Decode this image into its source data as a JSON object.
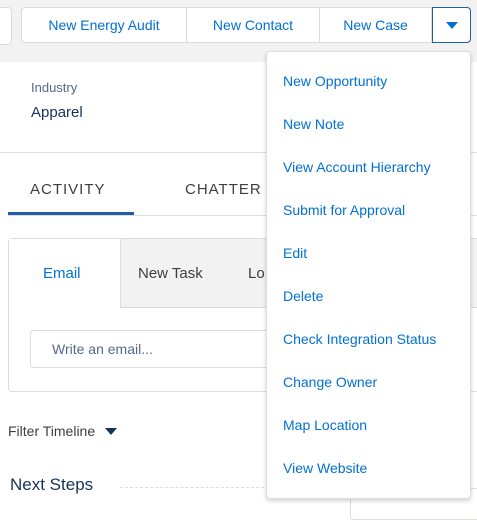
{
  "action_bar": {
    "buttons": [
      "New Energy Audit",
      "New Contact",
      "New Case"
    ],
    "more_icon": "chevron-down-icon"
  },
  "detail": {
    "field_label": "Industry",
    "field_value": "Apparel"
  },
  "tabs": [
    "ACTIVITY",
    "CHATTER"
  ],
  "publisher": {
    "tabs": [
      "Email",
      "New Task",
      "Lo"
    ],
    "email_placeholder": "Write an email..."
  },
  "timeline": {
    "filter_label": "Filter Timeline",
    "next_steps_label": "Next Steps"
  },
  "dropdown_menu": {
    "items": [
      "New Opportunity",
      "New Note",
      "View Account Hierarchy",
      "Submit for Approval",
      "Edit",
      "Delete",
      "Check Integration Status",
      "Change Owner",
      "Map Location",
      "View Website"
    ]
  },
  "colors": {
    "link_blue": "#0070d2",
    "active_tab_blue": "#1b5fa6",
    "border": "#dddbda",
    "background_gray": "#f3f2f2"
  }
}
